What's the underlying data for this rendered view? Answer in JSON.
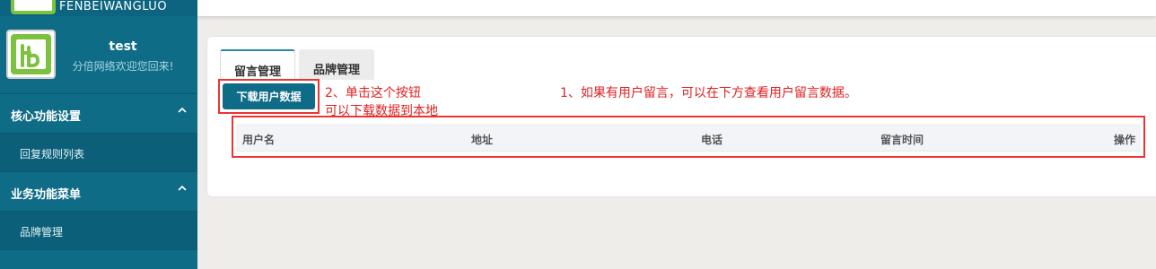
{
  "brand": {
    "text": "FENBEIWANGLUO"
  },
  "user": {
    "name": "test",
    "greeting": "分倍网络欢迎您回来!"
  },
  "menu": [
    {
      "label": "核心功能设置",
      "expanded": true,
      "items": [
        "回复规则列表"
      ]
    },
    {
      "label": "业务功能菜单",
      "expanded": true,
      "items": [
        "品牌管理"
      ]
    }
  ],
  "tabs": [
    {
      "label": "留言管理",
      "active": true
    },
    {
      "label": "品牌管理",
      "active": false
    }
  ],
  "download_button": {
    "label": "下载用户数据"
  },
  "annotations": {
    "step2_line1": "2、单击这个按钮",
    "step2_line2": "可以下载数据到本地",
    "step1": "1、如果有用户留言，可以在下方查看用户留言数据。"
  },
  "table": {
    "columns": [
      "用户名",
      "地址",
      "电话",
      "留言时间",
      "操作"
    ]
  },
  "colors": {
    "sidebar": "#0f6c87",
    "accent": "#0f6c87",
    "annotation_red": "#e02020",
    "logo_green": "#7cc23f"
  }
}
